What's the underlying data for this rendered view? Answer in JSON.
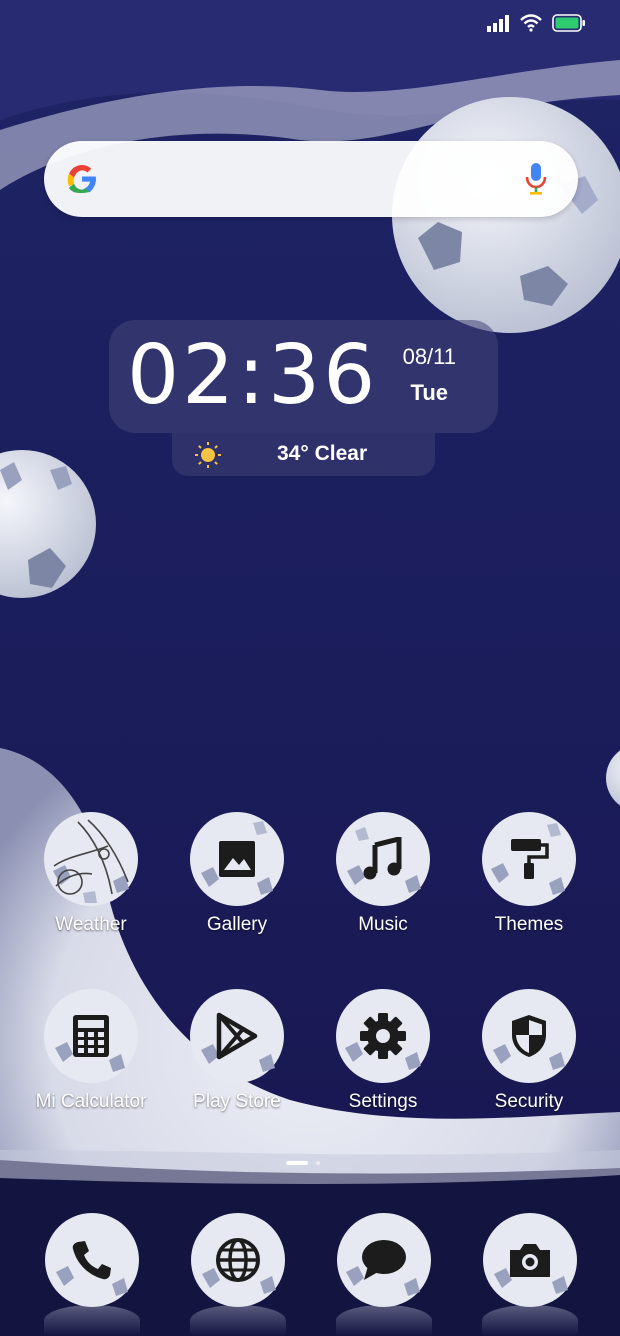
{
  "status_bar": {
    "signal_icon": "signal-icon",
    "wifi_icon": "wifi-icon",
    "battery_icon": "battery-icon",
    "battery_color": "#2ecc71"
  },
  "search": {
    "logo_icon": "google-g-icon",
    "mic_icon": "mic-icon"
  },
  "clock": {
    "time": "02:36",
    "date": "08/11",
    "day": "Tue"
  },
  "weather": {
    "icon": "sun-icon",
    "text": "34° Clear"
  },
  "apps": [
    {
      "label": "Weather",
      "icon": "weather-icon"
    },
    {
      "label": "Gallery",
      "icon": "image-icon"
    },
    {
      "label": "Music",
      "icon": "music-note-icon"
    },
    {
      "label": "Themes",
      "icon": "paint-roller-icon"
    },
    {
      "label": "Mi Calculator",
      "icon": "calculator-icon"
    },
    {
      "label": "Play Store",
      "icon": "play-store-icon"
    },
    {
      "label": "Settings",
      "icon": "gear-icon"
    },
    {
      "label": "Security",
      "icon": "shield-icon"
    }
  ],
  "page_indicator": {
    "pages": 2,
    "current": 1
  },
  "dock": [
    {
      "name": "Phone",
      "icon": "phone-icon"
    },
    {
      "name": "Browser",
      "icon": "globe-icon"
    },
    {
      "name": "Messaging",
      "icon": "chat-bubble-icon"
    },
    {
      "name": "Camera",
      "icon": "camera-icon"
    }
  ],
  "colors": {
    "background": "#1a1a5c",
    "moon": "#e8ebf2",
    "glyph": "#1c1c1c"
  }
}
